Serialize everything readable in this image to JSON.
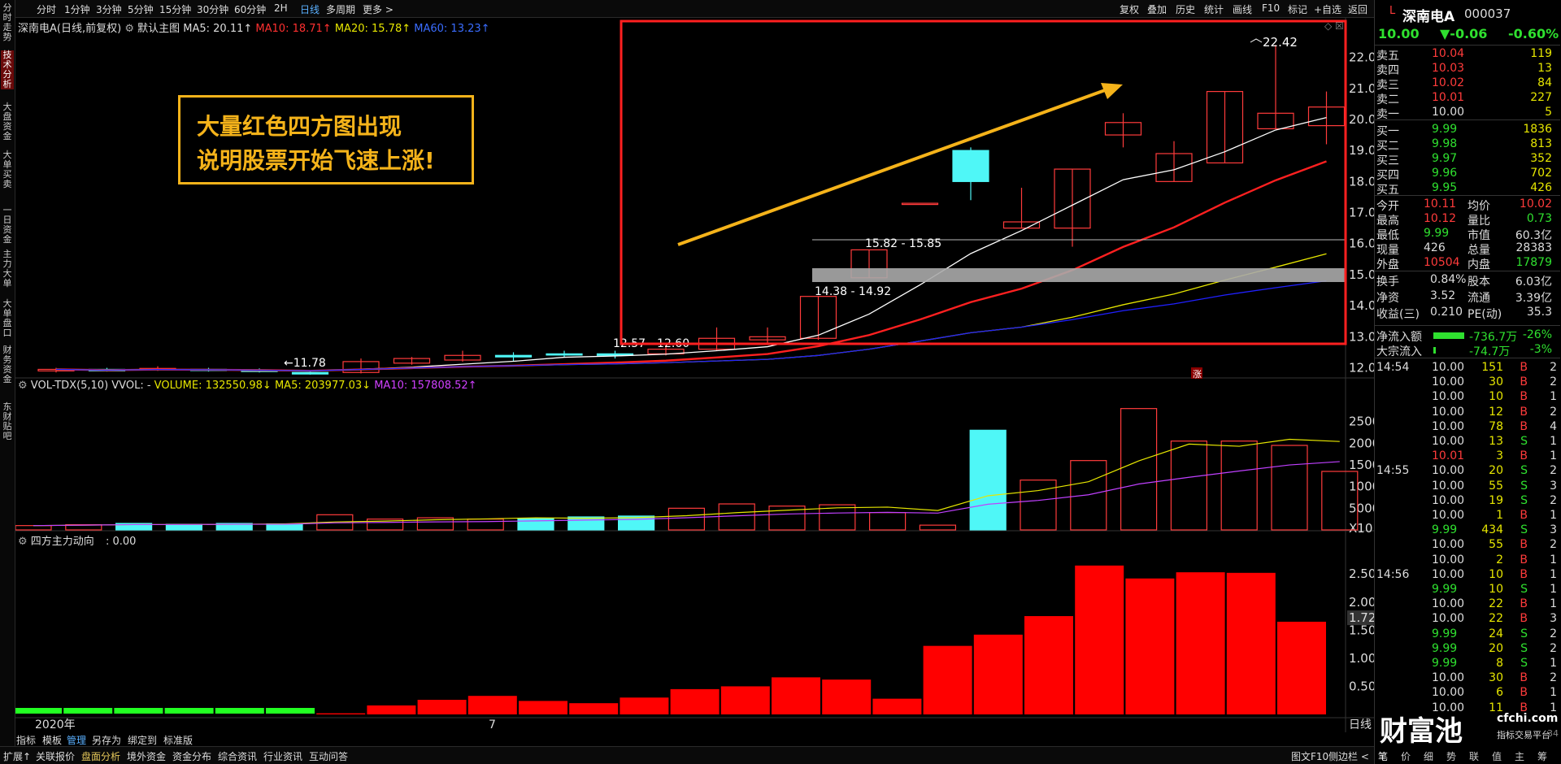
{
  "toolbar": {
    "intervals": [
      "分时",
      "1分钟",
      "3分钟",
      "5分钟",
      "15分钟",
      "30分钟",
      "60分钟",
      "2H",
      "日线",
      "多周期",
      "更多 >"
    ],
    "active": "日线",
    "right_items": [
      "复权",
      "叠加",
      "历史",
      "统计",
      "画线",
      "F10",
      "标记",
      "+自选",
      "返回"
    ]
  },
  "leftbar": {
    "tabs": [
      "分时走势",
      "技术分析",
      "大盘资金",
      "大单买卖",
      "一日资金",
      "主力大单",
      "大单盘口",
      "财务资金",
      "东财贴吧"
    ],
    "active": "技术分析"
  },
  "main_legend": {
    "stock": "深南电A(日线,前复权)",
    "template": "默认主图",
    "ma5": "MA5: 20.11↑",
    "ma10": "MA10: 18.71↑",
    "ma20": "MA20: 15.78↑",
    "ma60": "MA60: 13.23↑"
  },
  "vol_legend": {
    "name": "VOL-TDX(5,10) VVOL: -",
    "volume": "VOLUME: 132550.98↓",
    "ma5": "MA5: 203977.03↓",
    "ma10": "MA10: 157808.52↑"
  },
  "ind_legend": {
    "name": "四方主力动向",
    "value": ": 0.00"
  },
  "annotation": {
    "line1": "大量红色四方图出现",
    "line2": "说明股票开始飞速上涨!"
  },
  "price_labels": {
    "high": "22.42",
    "low_left": "←11.78",
    "band1": "15.82 - 15.85",
    "band2": "14.38 - 14.92",
    "band3": "12.57 - 12.60",
    "rise_mark": "涨"
  },
  "price_axis": [
    "22.00",
    "21.00",
    "20.00",
    "19.00",
    "18.00",
    "17.00",
    "16.00",
    "15.00",
    "14.00",
    "13.00",
    "12.00"
  ],
  "vol_axis": [
    "25000",
    "20000",
    "15000",
    "10000",
    "5000",
    "X10"
  ],
  "ind_axis": [
    "2.50",
    "2.00",
    "1.72",
    "1.50",
    "1.00",
    "0.50"
  ],
  "date_axis": {
    "left": "2020年",
    "mid": "7",
    "right": "日线"
  },
  "chart_data": {
    "type": "candlestick",
    "price_range": [
      11.7,
      22.8
    ],
    "candles": [
      {
        "o": 11.9,
        "h": 12.0,
        "l": 11.85,
        "c": 11.95,
        "up": true
      },
      {
        "o": 11.95,
        "h": 12.0,
        "l": 11.88,
        "c": 11.9,
        "up": false
      },
      {
        "o": 11.95,
        "h": 12.05,
        "l": 11.9,
        "c": 11.98,
        "up": true
      },
      {
        "o": 11.95,
        "h": 12.0,
        "l": 11.88,
        "c": 11.92,
        "up": false
      },
      {
        "o": 11.93,
        "h": 11.98,
        "l": 11.85,
        "c": 11.88,
        "up": false
      },
      {
        "o": 11.85,
        "h": 11.9,
        "l": 11.78,
        "c": 11.8,
        "up": false
      },
      {
        "o": 11.85,
        "h": 12.3,
        "l": 11.82,
        "c": 12.2,
        "up": true
      },
      {
        "o": 12.15,
        "h": 12.35,
        "l": 12.1,
        "c": 12.3,
        "up": true
      },
      {
        "o": 12.25,
        "h": 12.55,
        "l": 12.2,
        "c": 12.4,
        "up": true
      },
      {
        "o": 12.4,
        "h": 12.5,
        "l": 12.2,
        "c": 12.35,
        "up": false
      },
      {
        "o": 12.45,
        "h": 12.55,
        "l": 12.35,
        "c": 12.45,
        "up": false
      },
      {
        "o": 12.45,
        "h": 12.55,
        "l": 12.3,
        "c": 12.4,
        "up": false
      },
      {
        "o": 12.45,
        "h": 12.7,
        "l": 12.4,
        "c": 12.6,
        "up": true
      },
      {
        "o": 12.6,
        "h": 13.3,
        "l": 12.55,
        "c": 12.95,
        "up": true
      },
      {
        "o": 12.9,
        "h": 13.3,
        "l": 12.8,
        "c": 13.0,
        "up": true
      },
      {
        "o": 12.95,
        "h": 14.3,
        "l": 12.9,
        "c": 14.3,
        "up": true
      },
      {
        "o": 14.9,
        "h": 15.8,
        "l": 14.9,
        "c": 15.8,
        "up": true
      },
      {
        "o": 17.3,
        "h": 17.3,
        "l": 17.3,
        "c": 17.3,
        "up": true
      },
      {
        "o": 19.0,
        "h": 19.1,
        "l": 17.4,
        "c": 18.0,
        "up": false
      },
      {
        "o": 16.5,
        "h": 17.8,
        "l": 16.5,
        "c": 16.7,
        "up": true
      },
      {
        "o": 16.5,
        "h": 18.4,
        "l": 15.9,
        "c": 18.4,
        "up": true
      },
      {
        "o": 19.5,
        "h": 20.2,
        "l": 19.1,
        "c": 19.9,
        "up": true
      },
      {
        "o": 18.0,
        "h": 19.3,
        "l": 18.0,
        "c": 18.9,
        "up": true
      },
      {
        "o": 18.6,
        "h": 20.9,
        "l": 18.6,
        "c": 20.9,
        "up": true
      },
      {
        "o": 19.7,
        "h": 22.4,
        "l": 19.7,
        "c": 20.2,
        "up": true
      },
      {
        "o": 19.8,
        "h": 20.9,
        "l": 19.2,
        "c": 20.4,
        "up": true
      }
    ],
    "volume": [
      1000,
      1200,
      1500,
      1300,
      1500,
      1400,
      3500,
      2500,
      2800,
      2500,
      2700,
      3000,
      3200,
      5000,
      6000,
      5500,
      5800,
      4000,
      1100,
      23000,
      11500,
      16000,
      28000,
      20500,
      20500,
      19500,
      13500
    ],
    "volume_up": [
      true,
      true,
      false,
      false,
      false,
      false,
      true,
      true,
      true,
      true,
      false,
      false,
      false,
      true,
      true,
      true,
      true,
      true,
      true,
      false,
      true,
      true,
      true,
      true,
      true,
      true,
      true
    ],
    "indicator": [
      -0.05,
      -0.05,
      -0.05,
      -0.05,
      -0.05,
      -0.05,
      0.02,
      0.16,
      0.26,
      0.33,
      0.24,
      0.2,
      0.3,
      0.45,
      0.5,
      0.66,
      0.62,
      0.28,
      1.22,
      1.42,
      1.75,
      2.65,
      2.42,
      2.53,
      2.52,
      1.65
    ]
  },
  "quote": {
    "code_label": "L",
    "name": "深南电A",
    "code": "000037",
    "price": "10.00",
    "change": "▼-0.06",
    "pct": "-0.60%",
    "asks": [
      {
        "label": "卖五",
        "price": "10.04",
        "vol": "119"
      },
      {
        "label": "卖四",
        "price": "10.03",
        "vol": "13"
      },
      {
        "label": "卖三",
        "price": "10.02",
        "vol": "84"
      },
      {
        "label": "卖二",
        "price": "10.01",
        "vol": "227"
      },
      {
        "label": "卖一",
        "price": "10.00",
        "vol": "5"
      }
    ],
    "bids": [
      {
        "label": "买一",
        "price": "9.99",
        "vol": "1836"
      },
      {
        "label": "买二",
        "price": "9.98",
        "vol": "813"
      },
      {
        "label": "买三",
        "price": "9.97",
        "vol": "352"
      },
      {
        "label": "买四",
        "price": "9.96",
        "vol": "702"
      },
      {
        "label": "买五",
        "price": "9.95",
        "vol": "426"
      }
    ],
    "stats": [
      {
        "l1": "今开",
        "v1": "10.11",
        "l2": "均价",
        "v2": "10.02",
        "c1": "#ff3b3b",
        "c2": "#ff3b3b"
      },
      {
        "l1": "最高",
        "v1": "10.12",
        "l2": "量比",
        "v2": "0.73",
        "c1": "#ff3b3b",
        "c2": "#2fe02f"
      },
      {
        "l1": "最低",
        "v1": "9.99",
        "l2": "市值",
        "v2": "60.3亿",
        "c1": "#2fe02f",
        "c2": "#ddd"
      },
      {
        "l1": "现量",
        "v1": "426",
        "l2": "总量",
        "v2": "28383",
        "c1": "#ddd",
        "c2": "#ddd"
      },
      {
        "l1": "外盘",
        "v1": "10504",
        "l2": "内盘",
        "v2": "17879",
        "c1": "#ff3b3b",
        "c2": "#2fe02f"
      }
    ],
    "stats2": [
      {
        "l1": "换手",
        "v1": "0.84%",
        "l2": "股本",
        "v2": "6.03亿"
      },
      {
        "l1": "净资",
        "v1": "3.52",
        "l2": "流通",
        "v2": "3.39亿"
      },
      {
        "l1": "收益(三)",
        "v1": "0.210",
        "l2": "PE(动)",
        "v2": "35.3"
      }
    ],
    "flow": [
      {
        "label": "净流入额",
        "value": "-736.7万",
        "pct": "-26%"
      },
      {
        "label": "大宗流入",
        "value": "-74.7万",
        "pct": "-3%"
      }
    ],
    "ticks": [
      {
        "t": "14:54",
        "p": "10.00",
        "v": "151",
        "s": "B",
        "n": "2"
      },
      {
        "t": "",
        "p": "10.00",
        "v": "30",
        "s": "B",
        "n": "2"
      },
      {
        "t": "",
        "p": "10.00",
        "v": "10",
        "s": "B",
        "n": "1"
      },
      {
        "t": "",
        "p": "10.00",
        "v": "12",
        "s": "B",
        "n": "2"
      },
      {
        "t": "",
        "p": "10.00",
        "v": "78",
        "s": "B",
        "n": "4"
      },
      {
        "t": "",
        "p": "10.00",
        "v": "13",
        "s": "S",
        "n": "1"
      },
      {
        "t": "",
        "p": "10.01",
        "v": "3",
        "s": "B",
        "n": "1"
      },
      {
        "t": "14:55",
        "p": "10.00",
        "v": "20",
        "s": "S",
        "n": "2"
      },
      {
        "t": "",
        "p": "10.00",
        "v": "55",
        "s": "S",
        "n": "3"
      },
      {
        "t": "",
        "p": "10.00",
        "v": "19",
        "s": "S",
        "n": "2"
      },
      {
        "t": "",
        "p": "10.00",
        "v": "1",
        "s": "B",
        "n": "1"
      },
      {
        "t": "",
        "p": "9.99",
        "v": "434",
        "s": "S",
        "n": "3"
      },
      {
        "t": "",
        "p": "10.00",
        "v": "55",
        "s": "B",
        "n": "2"
      },
      {
        "t": "",
        "p": "10.00",
        "v": "2",
        "s": "B",
        "n": "1"
      },
      {
        "t": "14:56",
        "p": "10.00",
        "v": "10",
        "s": "B",
        "n": "1"
      },
      {
        "t": "",
        "p": "9.99",
        "v": "10",
        "s": "S",
        "n": "1"
      },
      {
        "t": "",
        "p": "10.00",
        "v": "22",
        "s": "B",
        "n": "1"
      },
      {
        "t": "",
        "p": "10.00",
        "v": "22",
        "s": "B",
        "n": "3"
      },
      {
        "t": "",
        "p": "9.99",
        "v": "24",
        "s": "S",
        "n": "2"
      },
      {
        "t": "",
        "p": "9.99",
        "v": "20",
        "s": "S",
        "n": "2"
      },
      {
        "t": "",
        "p": "9.99",
        "v": "8",
        "s": "S",
        "n": "1"
      },
      {
        "t": "",
        "p": "10.00",
        "v": "30",
        "s": "B",
        "n": "2"
      },
      {
        "t": "",
        "p": "10.00",
        "v": "6",
        "s": "B",
        "n": "1"
      },
      {
        "t": "",
        "p": "10.00",
        "v": "11",
        "s": "B",
        "n": "1"
      }
    ],
    "bottom_tabs": [
      "笔",
      "价",
      "细",
      "势",
      "联",
      "值",
      "主",
      "筹"
    ],
    "watermark": "财富池",
    "watermark_url": "cfchi.com",
    "watermark_sub": "指标交易平台",
    "footer_num": "34"
  },
  "tabbar": [
    "指标",
    "模板",
    "管理",
    "另存为",
    "绑定到",
    "标准版"
  ],
  "bottombar": [
    "扩展↑",
    "关联报价",
    "盘面分析",
    "境外资金",
    "资金分布",
    "综合资讯",
    "行业资讯",
    "互动问答"
  ],
  "bottombar_right": [
    "图文F10",
    "侧边栏 <"
  ],
  "colors": {
    "up": "#ff3b3b",
    "down": "#4ff7f7",
    "ma5": "#ffffff",
    "ma10": "#ff2020",
    "ma20": "#e6e600",
    "ma60": "#2020ff",
    "ind_pos": "#ff0000",
    "ind_neg": "#22ff22",
    "annotation": "#f5b31a"
  }
}
